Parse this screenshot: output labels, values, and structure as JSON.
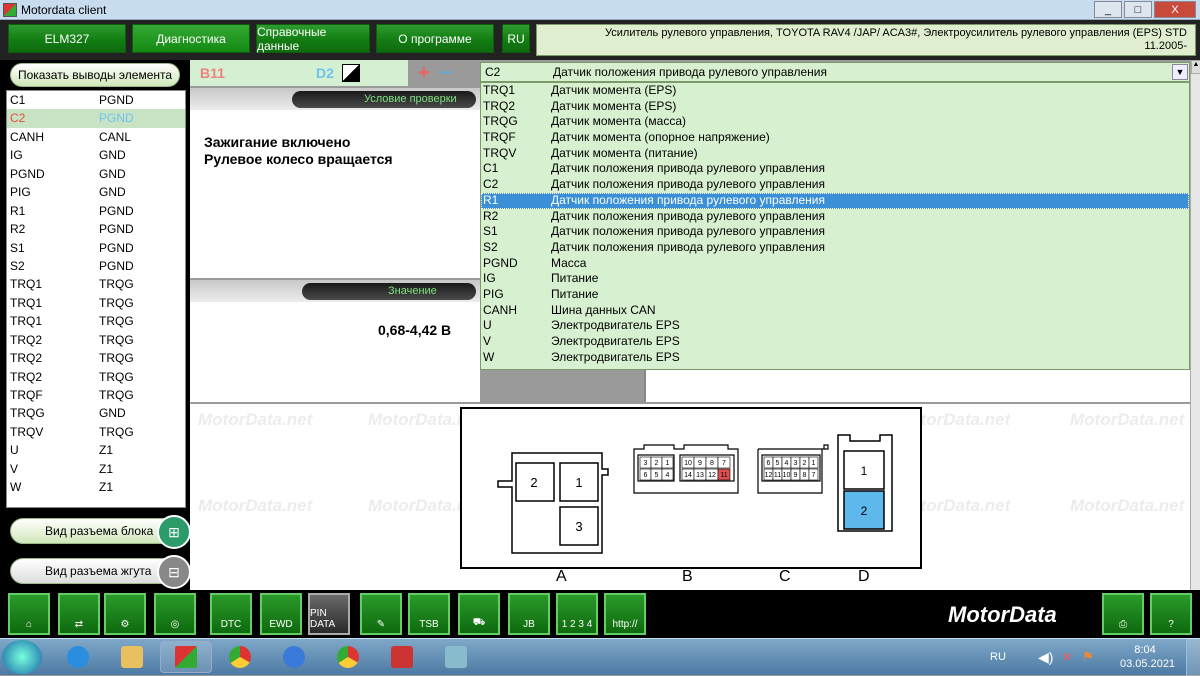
{
  "window": {
    "title": "Motordata client",
    "buttons": [
      "_",
      "□",
      "X"
    ]
  },
  "toolbar": {
    "buttons": [
      {
        "label": "ELM327"
      },
      {
        "label": "Диагностика"
      },
      {
        "label": "Справочные данные"
      },
      {
        "label": "О программе"
      },
      {
        "label": "RU"
      }
    ],
    "info_line1": "Усилитель рулевого управления, TOYOTA  RAV4 /JAP/  ACA3#,  Электроусилитель рулевого управления (EPS)  STD",
    "info_line2": "11.2005-"
  },
  "left": {
    "show_pins_label": "Показать выводы элемента",
    "pins": [
      {
        "a": "C1",
        "b": "PGND"
      },
      {
        "a": "C2",
        "b": "PGND",
        "selected": true
      },
      {
        "a": "CANH",
        "b": "CANL"
      },
      {
        "a": "IG",
        "b": "GND"
      },
      {
        "a": "PGND",
        "b": "GND"
      },
      {
        "a": "PIG",
        "b": "GND"
      },
      {
        "a": "R1",
        "b": "PGND"
      },
      {
        "a": "R2",
        "b": "PGND"
      },
      {
        "a": "S1",
        "b": "PGND"
      },
      {
        "a": "S2",
        "b": "PGND"
      },
      {
        "a": "TRQ1",
        "b": "TRQG"
      },
      {
        "a": "TRQ1",
        "b": "TRQG"
      },
      {
        "a": "TRQ1",
        "b": "TRQG"
      },
      {
        "a": "TRQ2",
        "b": "TRQG"
      },
      {
        "a": "TRQ2",
        "b": "TRQG"
      },
      {
        "a": "TRQ2",
        "b": "TRQG"
      },
      {
        "a": "TRQF",
        "b": "TRQG"
      },
      {
        "a": "TRQG",
        "b": "GND"
      },
      {
        "a": "TRQV",
        "b": "TRQG"
      },
      {
        "a": "U",
        "b": "Z1"
      },
      {
        "a": "V",
        "b": "Z1"
      },
      {
        "a": "W",
        "b": "Z1"
      }
    ],
    "block_view_label": "Вид разъема блока",
    "harness_view_label": "Вид разъема жгута"
  },
  "pinbar": {
    "pin1": "B11",
    "pin2": "D2",
    "plus": "+",
    "minus": "−"
  },
  "condition": {
    "header": "Условие проверки",
    "line1": "Зажигание включено",
    "line2": "Рулевое колесо вращается"
  },
  "value": {
    "header": "Значение",
    "text": "0,68-4,42 В"
  },
  "select": {
    "code": "C2",
    "desc": "Датчик положения привода рулевого управления",
    "options": [
      {
        "code": "TRQ1",
        "desc": "Датчик момента (EPS)"
      },
      {
        "code": "TRQ2",
        "desc": "Датчик момента (EPS)"
      },
      {
        "code": "TRQG",
        "desc": "Датчик момента (масса)"
      },
      {
        "code": "TRQF",
        "desc": "Датчик момента (опорное напряжение)"
      },
      {
        "code": "TRQV",
        "desc": "Датчик момента (питание)"
      },
      {
        "code": "C1",
        "desc": "Датчик положения привода рулевого управления"
      },
      {
        "code": "C2",
        "desc": "Датчик положения привода рулевого управления"
      },
      {
        "code": "R1",
        "desc": "Датчик положения привода рулевого управления",
        "highlighted": true
      },
      {
        "code": "R2",
        "desc": "Датчик положения привода рулевого управления"
      },
      {
        "code": "S1",
        "desc": "Датчик положения привода рулевого управления"
      },
      {
        "code": "S2",
        "desc": "Датчик положения привода рулевого управления"
      },
      {
        "code": "PGND",
        "desc": "Масса"
      },
      {
        "code": "IG",
        "desc": "Питание"
      },
      {
        "code": "PIG",
        "desc": "Питание"
      },
      {
        "code": "CANH",
        "desc": "Шина данных CAN"
      },
      {
        "code": "U",
        "desc": "Электродвигатель EPS"
      },
      {
        "code": "V",
        "desc": "Электродвигатель EPS"
      },
      {
        "code": "W",
        "desc": "Электродвигатель EPS"
      }
    ]
  },
  "diagram": {
    "watermark": "MotorData.net",
    "labels": [
      "A",
      "B",
      "C",
      "D"
    ],
    "connA": [
      "2",
      "1",
      "3"
    ],
    "connB_top_left": [
      "3",
      "2",
      "1"
    ],
    "connB_bottom_left": [
      "6",
      "5",
      "4"
    ],
    "connB_top_right": [
      "10",
      "9",
      "8",
      "7"
    ],
    "connB_bottom_right": [
      "14",
      "13",
      "12",
      "11"
    ],
    "connC_top": [
      "6",
      "5",
      "4",
      "3",
      "2",
      "1"
    ],
    "connC_bottom": [
      "12",
      "11",
      "10",
      "9",
      "8",
      "7"
    ],
    "connD": [
      "1",
      "2"
    ],
    "highlight_color": "#e05050",
    "d_highlight_color": "#5fb8ec"
  },
  "bottom": {
    "buttons": [
      "DTC",
      "EWD",
      "PIN DATA",
      "TSB",
      "JB",
      "1 2 3 4",
      "http://"
    ],
    "logo": "MotorData"
  },
  "taskbar": {
    "lang": "RU",
    "time": "8:04",
    "date": "03.05.2021"
  }
}
